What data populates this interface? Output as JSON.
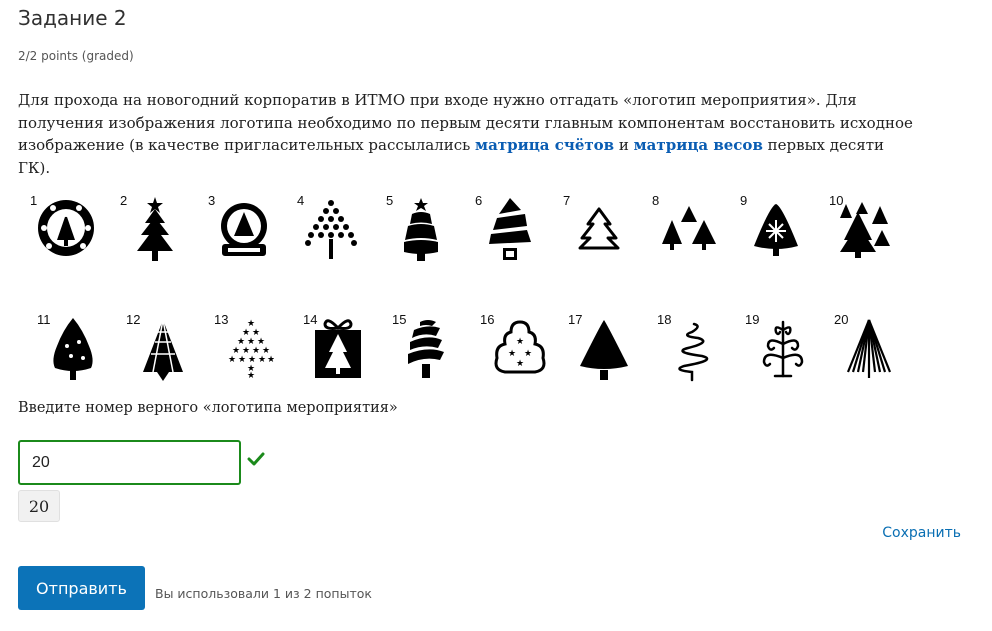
{
  "problem": {
    "title": "Задание 2",
    "points": "2/2 points (graded)",
    "text_part1": "Для прохода на новогодний корпоратив в ИТМО при входе нужно отгадать «логотип мероприятия». Для получения изображения логотипа необходимо по первым десяти главным компонентам восстановить исходное изображение (в качестве пригласительных рассылались ",
    "link1": "матрица счётов",
    "text_and": " и ",
    "link2": "матрица весов",
    "text_part2": " первых десяти ГК)."
  },
  "logos": [
    {
      "num": "1",
      "icon": "wreath-tree-icon"
    },
    {
      "num": "2",
      "icon": "star-tree-icon"
    },
    {
      "num": "3",
      "icon": "snow-globe-icon"
    },
    {
      "num": "4",
      "icon": "dotted-tree-icon"
    },
    {
      "num": "5",
      "icon": "bell-tree-icon"
    },
    {
      "num": "6",
      "icon": "spiral-tree-icon"
    },
    {
      "num": "7",
      "icon": "outline-tree-icon"
    },
    {
      "num": "8",
      "icon": "three-trees-icon"
    },
    {
      "num": "9",
      "icon": "snowflake-tree-icon"
    },
    {
      "num": "10",
      "icon": "forest-icon"
    },
    {
      "num": "11",
      "icon": "rounded-tree-icon"
    },
    {
      "num": "12",
      "icon": "triangles-tree-icon"
    },
    {
      "num": "13",
      "icon": "stars-tree-icon"
    },
    {
      "num": "14",
      "icon": "gift-box-tree-icon"
    },
    {
      "num": "15",
      "icon": "striped-tree-icon"
    },
    {
      "num": "16",
      "icon": "cloud-tree-icon"
    },
    {
      "num": "17",
      "icon": "solid-tree-icon"
    },
    {
      "num": "18",
      "icon": "swirl-tree-icon"
    },
    {
      "num": "19",
      "icon": "curl-tree-icon"
    },
    {
      "num": "20",
      "icon": "lined-tree-icon"
    }
  ],
  "question": "Введите номер верного «логотипа мероприятия»",
  "answer": {
    "value": "20",
    "preview": "20",
    "status": "correct"
  },
  "actions": {
    "save": "Сохранить",
    "submit": "Отправить",
    "attempts": "Вы использовали 1 из 2 попыток"
  },
  "colors": {
    "accent": "#0c73b8",
    "correct": "#1b8a1b",
    "link": "#0a5db3"
  }
}
